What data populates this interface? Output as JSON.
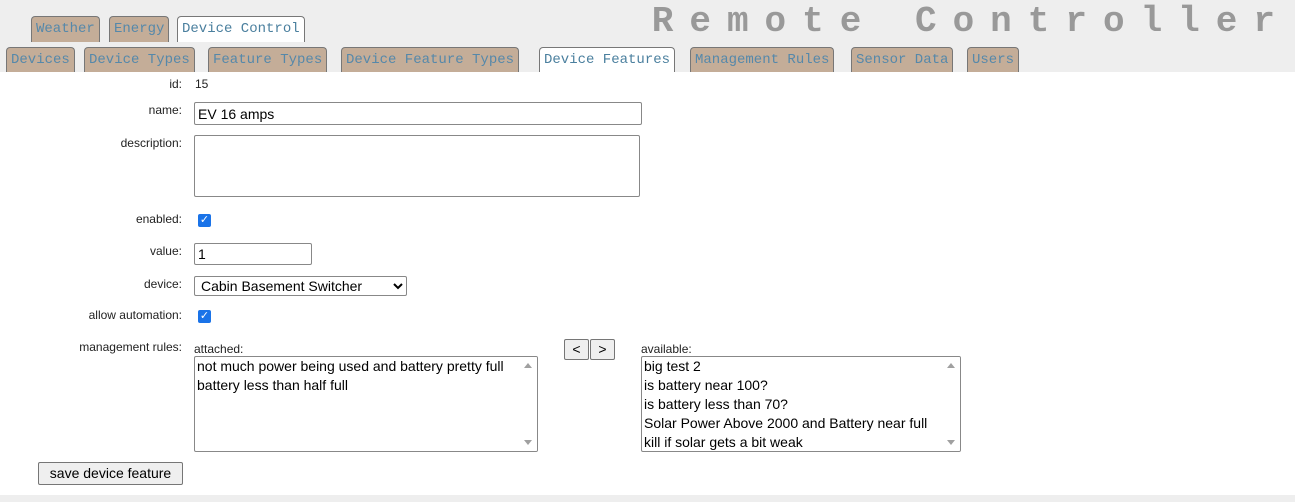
{
  "app": {
    "title": "Remote Controller"
  },
  "top_tabs": [
    {
      "label": "Weather",
      "active": false
    },
    {
      "label": "Energy",
      "active": false
    },
    {
      "label": "Device Control",
      "active": true
    }
  ],
  "sub_tabs": [
    {
      "label": "Devices",
      "active": false
    },
    {
      "label": "Device Types",
      "active": false
    },
    {
      "label": "Feature Types",
      "active": false
    },
    {
      "label": "Device Feature Types",
      "active": false
    },
    {
      "label": "Device Features",
      "active": true
    },
    {
      "label": "Management Rules",
      "active": false
    },
    {
      "label": "Sensor Data",
      "active": false
    },
    {
      "label": "Users",
      "active": false
    }
  ],
  "form": {
    "id_label": "id:",
    "id_value": "15",
    "name_label": "name:",
    "name_value": "EV 16 amps",
    "description_label": "description:",
    "description_value": "",
    "enabled_label": "enabled:",
    "enabled_checked": true,
    "value_label": "value:",
    "value_value": "1",
    "device_label": "device:",
    "device_selected": "Cabin Basement Switcher",
    "allow_automation_label": "allow automation:",
    "allow_automation_checked": true,
    "management_rules_label": "management rules:",
    "attached_label": "attached:",
    "attached_rules": [
      "not much power being used and battery pretty full",
      "battery less than half full"
    ],
    "available_label": "available:",
    "available_rules": [
      "big test 2",
      "is battery near 100?",
      "is battery less than 70?",
      "Solar Power Above 2000 and Battery near full",
      "kill if solar gets a bit weak"
    ],
    "move_left_label": "<",
    "move_right_label": ">",
    "save_label": "save device feature"
  },
  "colors": {
    "tab_bg": "#c4ad98",
    "tab_text": "#5588aa",
    "active_tab_bg": "#ffffff",
    "title_color": "#999999",
    "checkbox": "#1a73e8"
  }
}
